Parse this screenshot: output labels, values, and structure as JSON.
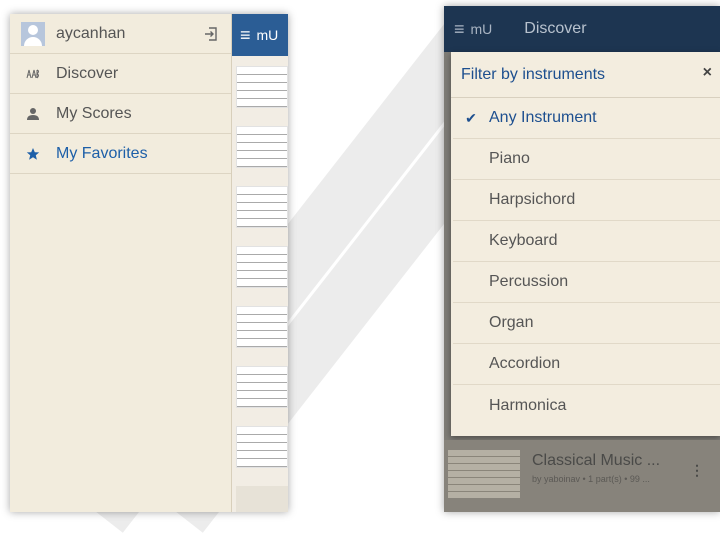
{
  "left": {
    "user": {
      "name": "aycanhan"
    },
    "drawer": {
      "items": [
        {
          "label": "Discover",
          "icon": "notes-icon"
        },
        {
          "label": "My Scores",
          "icon": "person-icon"
        },
        {
          "label": "My Favorites",
          "icon": "star-icon",
          "active": true
        }
      ]
    },
    "app_bar": {
      "menu_glyph": "≡",
      "logo": "mU"
    }
  },
  "right": {
    "app_bar": {
      "menu_glyph": "≡",
      "logo": "mU",
      "title": "Discover"
    },
    "filter": {
      "title": "Filter by instruments",
      "close_glyph": "×",
      "check_glyph": "✔",
      "instruments": [
        {
          "name": "Any Instrument",
          "selected": true
        },
        {
          "name": "Piano"
        },
        {
          "name": "Harpsichord"
        },
        {
          "name": "Keyboard"
        },
        {
          "name": "Percussion"
        },
        {
          "name": "Organ"
        },
        {
          "name": "Accordion"
        },
        {
          "name": "Harmonica"
        }
      ]
    },
    "list_item": {
      "title": "Classical Music ...",
      "subtitle": "by yaboinav • 1 part(s) • 99 ..."
    }
  },
  "colors": {
    "accent": "#1d5fa8",
    "drawer_bg": "#f2ecdd",
    "topbar_left": "#2b5d95",
    "topbar_right": "#1d3551"
  }
}
